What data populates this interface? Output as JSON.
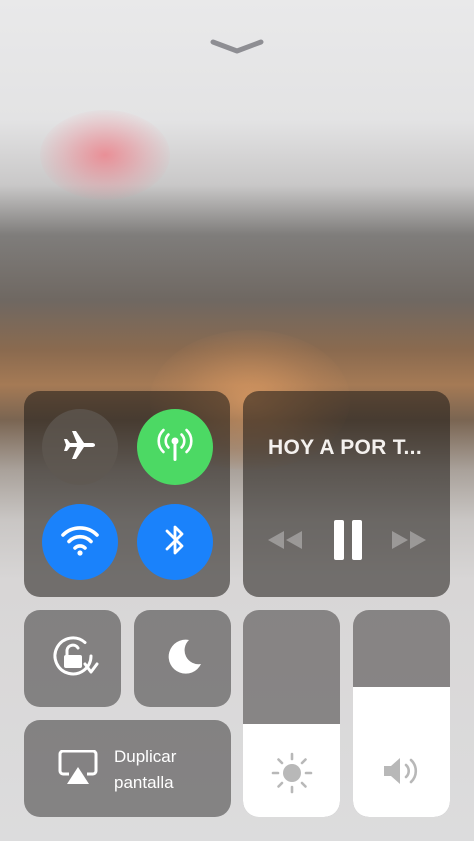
{
  "control_center": {
    "dismiss_icon": "chevron-down-icon",
    "connectivity": {
      "airplane_mode": {
        "icon": "airplane-icon",
        "enabled": false
      },
      "cellular_data": {
        "icon": "antenna-icon",
        "enabled": true,
        "color": "#4cd964"
      },
      "wifi": {
        "icon": "wifi-icon",
        "enabled": true,
        "color": "#1a82fb"
      },
      "bluetooth": {
        "icon": "bluetooth-icon",
        "enabled": true,
        "color": "#1a82fb"
      }
    },
    "now_playing": {
      "title": "HOY A POR T...",
      "controls": [
        "rewind-icon",
        "pause-icon",
        "fast-forward-icon"
      ]
    },
    "orientation_lock": {
      "icon": "rotation-lock-icon",
      "enabled": false
    },
    "do_not_disturb": {
      "icon": "moon-icon",
      "enabled": false
    },
    "screen_mirroring": {
      "icon": "airplay-icon",
      "label_line1": "Duplicar",
      "label_line2": "pantalla"
    },
    "brightness": {
      "icon": "sun-icon",
      "level": 0.45
    },
    "volume": {
      "icon": "speaker-icon",
      "level": 0.63
    }
  }
}
